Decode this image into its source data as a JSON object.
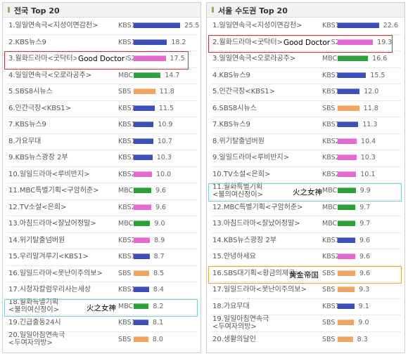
{
  "colors": {
    "KBS1": "#3d4fb8",
    "KBS2": "#e36bd0",
    "MBC": "#2ea03a",
    "SBS": "#f0a464",
    "highlight_red": "#c83a3a",
    "highlight_cyan": "#7fd0d6",
    "highlight_orange": "#e3a84c"
  },
  "chart_data": [
    {
      "type": "bar",
      "title": "전국 Top 20",
      "xlim": [
        0,
        30
      ],
      "categories": [
        "1.일일연속극<지성이면감천>",
        "2.KBS뉴스9",
        "3.월화드라마<굿닥터>",
        "4.일일연속극<오로라공주>",
        "5.SBS8시뉴스",
        "6.인간극장<KBS1>",
        "7.KBS뉴스9",
        "8.가요무대",
        "9.KBS뉴스광장 2부",
        "10.일일드라마<루비반지>",
        "11.MBC특별기획<구암허준>",
        "12.TV소설<은희>",
        "13.아침드라마<잘났어정말>",
        "14.위기탈출넘버원",
        "15.우리말겨루기<KBS1>",
        "16.일일드라마<못난이주의보>",
        "17.시청자칼럼우리사는세상",
        "18.월화특별기획<불의여신정이>",
        "19.긴급출동24시",
        "20.일일아침연속극<두여자의방>"
      ],
      "labels": [
        [
          "1.일일연속극<지성이면감천>"
        ],
        [
          "2.KBS뉴스9"
        ],
        [
          "3.월화드라마<굿닥터>"
        ],
        [
          "4.일일연속극<오로라공주>"
        ],
        [
          "5.SBS8시뉴스"
        ],
        [
          "6.인간극장<KBS1>"
        ],
        [
          "7.KBS뉴스9"
        ],
        [
          "8.가요무대"
        ],
        [
          "9.KBS뉴스광장 2부"
        ],
        [
          "10.일일드라마<루비반지>"
        ],
        [
          "11.MBC특별기획<구암허준>"
        ],
        [
          "12.TV소설<은희>"
        ],
        [
          "13.아침드라마<잘났어정말>"
        ],
        [
          "14.위기탈출넘버원"
        ],
        [
          "15.우리말겨루기<KBS1>"
        ],
        [
          "16.일일드라마<못난이주의보>"
        ],
        [
          "17.시청자칼럼우리사는세상"
        ],
        [
          "18.월화특별기획",
          "<불의여신정이>"
        ],
        [
          "19.긴급출동24시"
        ],
        [
          "20.일일아침연속극",
          "<두여자의방>"
        ]
      ],
      "networks": [
        "KBS1",
        "KBS1",
        "KBS2",
        "MBC",
        "SBS",
        "KBS1",
        "KBS1",
        "KBS1",
        "KBS1",
        "KBS2",
        "MBC",
        "KBS2",
        "MBC",
        "KBS2",
        "KBS1",
        "SBS",
        "KBS1",
        "MBC",
        "KBS1",
        "SBS"
      ],
      "values": [
        25.5,
        18.2,
        17.5,
        14.7,
        11.8,
        11.5,
        10.9,
        10.7,
        10.3,
        10.0,
        9.6,
        9.6,
        9.0,
        8.9,
        8.7,
        8.5,
        8.4,
        8.2,
        8.1,
        8.0
      ],
      "value_labels": [
        "25.5",
        "18.2",
        "17.5",
        "14.7",
        "11.8",
        "11.5",
        "10.9",
        "10.7",
        "10.3",
        "10.0",
        "9.6",
        "9.6",
        "9.0",
        "8.9",
        "8.7",
        "8.5",
        "8.4",
        "8.2",
        "8.1",
        "8.0"
      ],
      "annotations": [
        {
          "row": 2,
          "text": "Good Doctor",
          "box": "highlight_red"
        },
        {
          "row": 17,
          "text": "火之女神",
          "box": "highlight_cyan"
        }
      ]
    },
    {
      "type": "bar",
      "title": "서울 수도권 Top 20",
      "xlim": [
        0,
        30
      ],
      "categories": [
        "1.일일연속극<지성이면감천>",
        "2.월화드라마<굿닥터>",
        "3.일일연속극<오로라공주>",
        "4.KBS뉴스9",
        "5.인간극장<KBS1>",
        "6.SBS8시뉴스",
        "7.KBS뉴스9",
        "8.위기탈출넘버원",
        "9.일일드라마<루비반지>",
        "10.TV소설<은희>",
        "11.월화특별기획<불의여신정이>",
        "12.MBC특별기획<구암허준>",
        "13.아침드라마<잘났어정말>",
        "14.KBS뉴스광장 2부",
        "15.안녕하세요",
        "16.SBS대기획<황금의제국>",
        "17.일일드라마<못난이주의보>",
        "18.가요무대",
        "19.일일아침연속극<두여자의방>",
        "20.생활의달인"
      ],
      "labels": [
        [
          "1.일일연속극<지성이면감천>"
        ],
        [
          "2.월화드라마<굿닥터>"
        ],
        [
          "3.일일연속극<오로라공주>"
        ],
        [
          "4.KBS뉴스9"
        ],
        [
          "5.인간극장<KBS1>"
        ],
        [
          "6.SBS8시뉴스"
        ],
        [
          "7.KBS뉴스9"
        ],
        [
          "8.위기탈출넘버원"
        ],
        [
          "9.일일드라마<루비반지>"
        ],
        [
          "10.TV소설<은희>"
        ],
        [
          "11.월화특별기획",
          "<불의여신정이>"
        ],
        [
          "12.MBC특별기획<구암허준>"
        ],
        [
          "13.아침드라마<잘났어정말>"
        ],
        [
          "14.KBS뉴스광장 2부"
        ],
        [
          "15.안녕하세요"
        ],
        [
          "16.SBS대기획<황금의제국>"
        ],
        [
          "17.일일드라마<못난이주의보>"
        ],
        [
          "18.가요무대"
        ],
        [
          "19.일일아침연속극",
          "<두여자의방>"
        ],
        [
          "20.생활의달인"
        ]
      ],
      "networks": [
        "KBS1",
        "KBS2",
        "MBC",
        "KBS1",
        "KBS1",
        "SBS",
        "KBS1",
        "KBS2",
        "KBS2",
        "KBS2",
        "MBC",
        "MBC",
        "MBC",
        "KBS1",
        "KBS2",
        "SBS",
        "SBS",
        "KBS1",
        "SBS",
        "SBS"
      ],
      "values": [
        22.6,
        19.3,
        16.6,
        15.5,
        12.0,
        11.8,
        11.3,
        10.4,
        10.3,
        10.1,
        9.9,
        9.7,
        9.7,
        9.6,
        9.6,
        9.6,
        9.3,
        9.1,
        9.0,
        8.3
      ],
      "value_labels": [
        "22.6",
        "19.3",
        "16.6",
        "15.5",
        "12.0",
        "11.8",
        "11.3",
        "10.4",
        "10.3",
        "10.1",
        "9.9",
        "9.7",
        "9.7",
        "9.6",
        "9.6",
        "9.6",
        "9.3",
        "9.1",
        "9.0",
        "8.3"
      ],
      "annotations": [
        {
          "row": 1,
          "text": "Good Doctor",
          "box": "highlight_red"
        },
        {
          "row": 10,
          "text": "火之女神",
          "box": "highlight_cyan"
        },
        {
          "row": 15,
          "text": "黄金帝国",
          "box": "highlight_orange"
        }
      ]
    }
  ]
}
